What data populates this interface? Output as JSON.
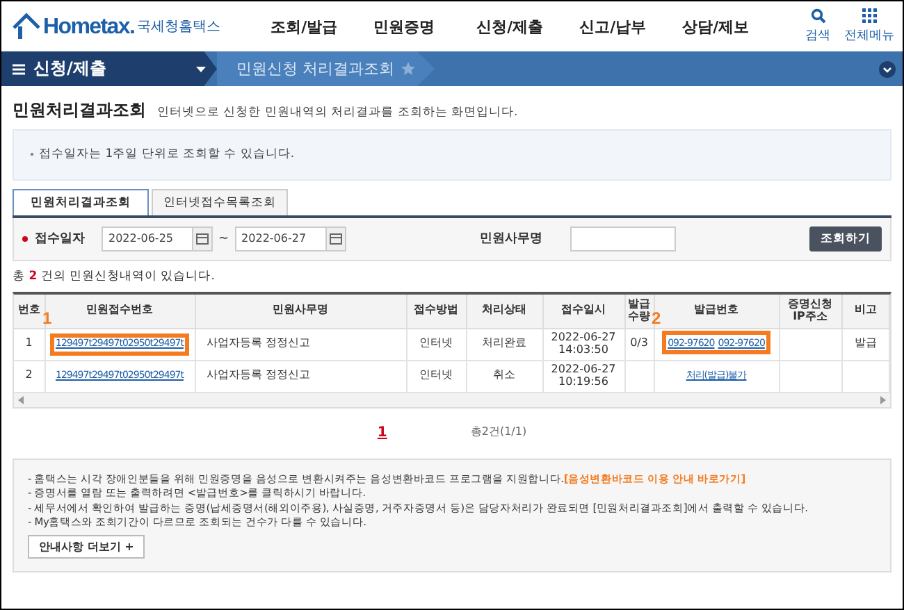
{
  "header": {
    "logo": "Hometax.",
    "brand": "국세청홈택스",
    "menu": [
      "조회/발급",
      "민원증명",
      "신청/제출",
      "신고/납부",
      "상담/제보"
    ],
    "tools": [
      {
        "label": "검색",
        "kind": "search"
      },
      {
        "label": "전체메뉴",
        "kind": "grid"
      }
    ]
  },
  "nav": {
    "section": "신청/제출",
    "page": "민원신청 처리결과조회",
    "favorite": false
  },
  "title": "민원처리결과조회",
  "subtitle": "인터넷으로 신청한 민원내역의 처리결과를 조회하는 화면입니다.",
  "notice": "접수일자는 1주일 단위로 조회할 수 있습니다.",
  "tabs": [
    {
      "label": "민원처리결과조회",
      "selected": true
    },
    {
      "label": "인터넷접수목록조회",
      "selected": false
    }
  ],
  "search": {
    "date_label": "접수일자",
    "required": true,
    "from": "2022-06-25",
    "separator": "~",
    "to": "2022-06-27",
    "office_label": "민원사무명",
    "button": "조회하기"
  },
  "summary": {
    "prefix": "총",
    "count": "2",
    "suffix": "건의 민원신청내역이 있습니다."
  },
  "table": {
    "columns": [
      "번호",
      "민원접수번호",
      "민원사무명",
      "접수방법",
      "처리상태",
      "접수일시",
      "발급\n수량",
      "발급번호",
      "증명신청\nIP주소",
      "비고"
    ],
    "rows": [
      {
        "no": "1",
        "receipt": "129497t29497t02950t29497t",
        "receipt_highlight": true,
        "receipt_callout": "1",
        "office": "사업자등록 정정신고",
        "method": "인터넷",
        "status": "처리완료",
        "date": "2022-06-27",
        "time": "14:03:50",
        "qty": "0/3",
        "issue": [
          "092-97620",
          "092-97620"
        ],
        "issue_highlight": true,
        "issue_callout": "2",
        "note": "발급"
      },
      {
        "no": "2",
        "receipt": "129497t29497t02950t29497t",
        "receipt_highlight": false,
        "office": "사업자등록 정정신고",
        "method": "인터넷",
        "status": "취소",
        "date": "2022-06-27",
        "time": "10:19:56",
        "issue": [
          "처리(발급)불가"
        ],
        "issue_highlight": false
      }
    ]
  },
  "pagination": {
    "pages": [
      {
        "label": "1",
        "selected": true
      }
    ],
    "total": "총2건(1/1)"
  },
  "notes": [
    {
      "text": "- 홈택스는 시각 장애인분들을 위해 민원증명을 음성으로 변환시켜주는 음성변환바코드 프로그램을 지원합니다.",
      "link": "[음성변환바코드 이용 안내 바로가기]"
    },
    {
      "text": "- 증명서를 열람 또는 출력하려면 <발급번호>를 클릭하시기 바랍니다."
    },
    {
      "text": "- 세무서에서 확인하여 발급하는 증명(납세증명서(해외이주용), 사실증명, 거주자증명서 등)은 담당자처리가 완료되면 [민원처리결과조회]에서 출력할 수 있습니다."
    },
    {
      "text": "- My홈택스와 조회기간이 다르므로 조회되는 건수가 다를 수 있습니다."
    }
  ],
  "more_button": "안내사항 더보기 +"
}
